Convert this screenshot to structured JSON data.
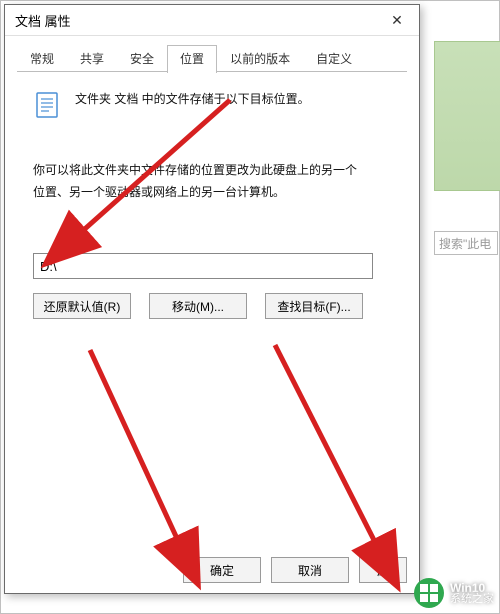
{
  "bg": {
    "search_placeholder": "搜索\"此电"
  },
  "dialog": {
    "title": "文档 属性",
    "close_glyph": "✕",
    "tabs": {
      "general": "常规",
      "sharing": "共享",
      "security": "安全",
      "location": "位置",
      "previous": "以前的版本",
      "customize": "自定义"
    },
    "info_line": "文件夹 文档 中的文件存储于以下目标位置。",
    "desc_line1": "你可以将此文件夹中文件存储的位置更改为此硬盘上的另一个",
    "desc_line2": "位置、另一个驱动器或网络上的另一台计算机。",
    "path_value": "D:\\",
    "buttons": {
      "restore": "还原默认值(R)",
      "move": "移动(M)...",
      "find": "查找目标(F)...",
      "ok": "确定",
      "cancel": "取消",
      "apply": "应"
    }
  },
  "watermark": {
    "line1": "Win10",
    "line2": "系统之家"
  }
}
